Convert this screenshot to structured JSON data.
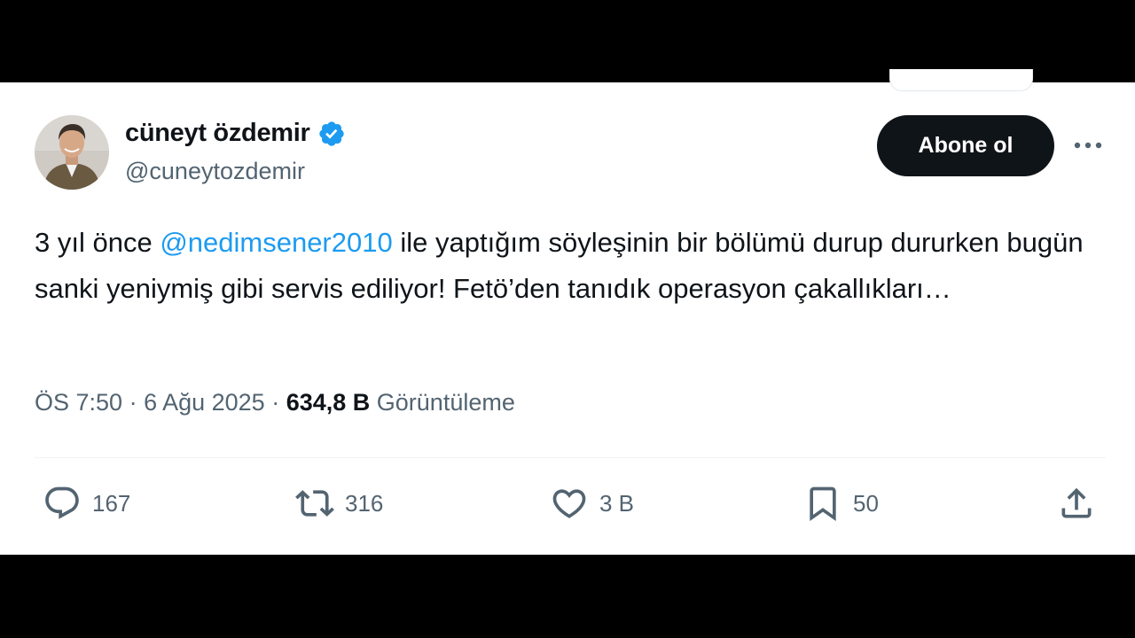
{
  "author": {
    "display_name": "cüneyt özdemir",
    "handle": "@cuneytozdemir",
    "verified_icon": "verified-badge-icon",
    "verified_color": "#1d9bf0"
  },
  "follow_button": {
    "label": "Abone ol"
  },
  "more_icon": "more-horizontal-icon",
  "tweet": {
    "text_before": "3 yıl önce ",
    "mention": "@nedimsener2010",
    "text_after": " ile yaptığım söyleşinin bir bölümü durup dururken bugün sanki yeniymiş gibi servis ediliyor! Fetö’den tanıdık operasyon çakallıkları…"
  },
  "meta": {
    "time": "ÖS 7:50",
    "separator": " · ",
    "date": "6 Ağu 2025",
    "views_count": "634,8 B",
    "views_label": " Görüntüleme"
  },
  "actions": {
    "reply": {
      "icon": "reply-icon",
      "count": "167"
    },
    "repost": {
      "icon": "repost-icon",
      "count": "316"
    },
    "like": {
      "icon": "heart-icon",
      "count": "3 B"
    },
    "bookmark": {
      "icon": "bookmark-icon",
      "count": "50"
    },
    "share": {
      "icon": "share-icon"
    }
  },
  "colors": {
    "text": "#0f1419",
    "secondary_text": "#536471",
    "link": "#1d9bf0",
    "button_bg": "#0f1419"
  }
}
